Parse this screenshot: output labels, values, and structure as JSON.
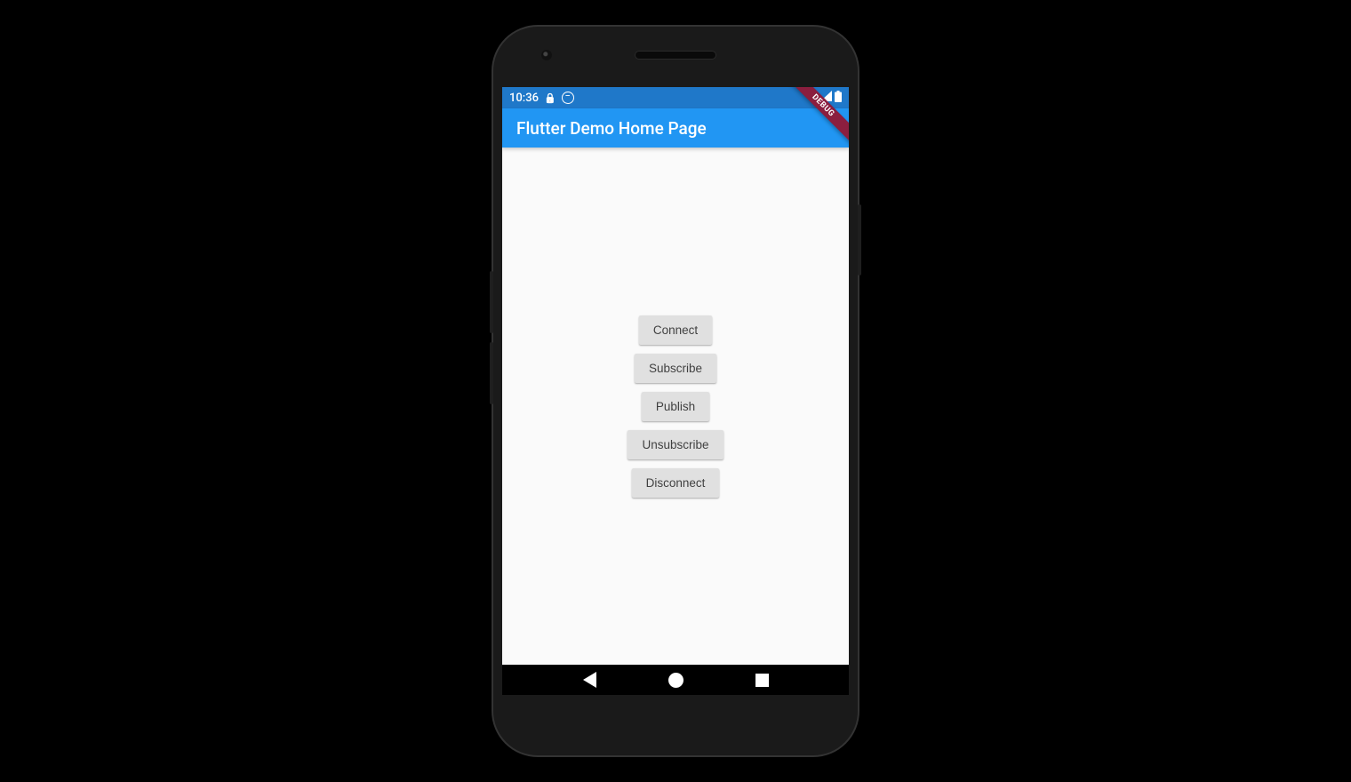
{
  "status_bar": {
    "time": "10:36",
    "debug_label": "DEBUG"
  },
  "app_bar": {
    "title": "Flutter Demo Home Page"
  },
  "buttons": {
    "connect": "Connect",
    "subscribe": "Subscribe",
    "publish": "Publish",
    "unsubscribe": "Unsubscribe",
    "disconnect": "Disconnect"
  },
  "colors": {
    "status_bar": "#1f78c9",
    "app_bar": "#2196F3",
    "button_bg": "#e0e0e0",
    "debug_banner": "#8B1E3F"
  }
}
